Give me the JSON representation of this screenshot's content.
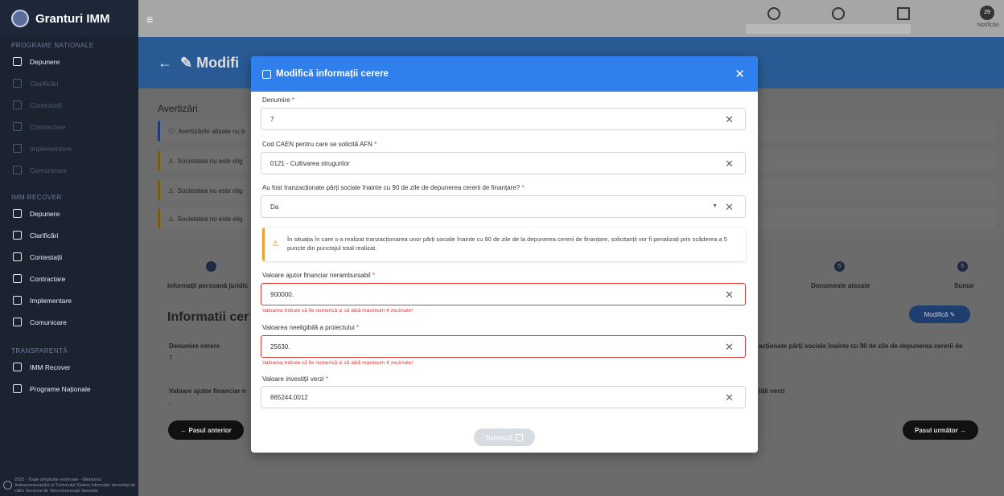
{
  "app": {
    "title": "Granturi IMM"
  },
  "sidebar": {
    "sections": [
      {
        "label": "PROGRAME NATIONALE",
        "items": [
          {
            "label": "Depunere",
            "active": true
          },
          {
            "label": "Clarificări",
            "active": false
          },
          {
            "label": "Contestații",
            "active": false
          },
          {
            "label": "Contractare",
            "active": false
          },
          {
            "label": "Implementare",
            "active": false
          },
          {
            "label": "Comunicare",
            "active": false
          }
        ]
      },
      {
        "label": "IMM RECOVER",
        "items": [
          {
            "label": "Depunere",
            "active": true
          },
          {
            "label": "Clarificări",
            "active": true
          },
          {
            "label": "Contestații",
            "active": true
          },
          {
            "label": "Contractare",
            "active": true
          },
          {
            "label": "Implementare",
            "active": true
          },
          {
            "label": "Comunicare",
            "active": true
          }
        ]
      },
      {
        "label": "TRANSPARENȚĂ",
        "items": [
          {
            "label": "IMM Recover",
            "active": true
          },
          {
            "label": "Programe Naționale",
            "active": true
          }
        ]
      }
    ],
    "footer": "2022 - Toate drepturile rezervate - Ministerul Antreprenoriatului și Turismului Sistem informatic dezvoltat de către Serviciul de Telecomunicații Speciale"
  },
  "topbar": {
    "notifications_label": "Notificări",
    "notifications_count": "29"
  },
  "page": {
    "title": "Modifi"
  },
  "warnings": {
    "title": "Avertizări",
    "rows": [
      "Avertizările afișate nu b",
      "Societatea nu este elig",
      "Societatea nu este elig",
      "Societatea nu este elig"
    ]
  },
  "wizard": {
    "steps_left": [
      "Informații persoană juridic"
    ],
    "steps_right": [
      "Documente atașate",
      "Sumar"
    ],
    "step_numbers": [
      "5",
      "6"
    ],
    "section_title": "Informatii cer",
    "modify_label": "Modifică",
    "field1_label": "Denumire cerere",
    "field1_value": "7",
    "field2_label": "Valoare ajutor financiar n",
    "field2_value": "-",
    "right_label1": "acționate părți sociale înainte cu 90 de zile de depunerea cererii de",
    "right_label2": "tiții verzi",
    "prev_label": "Pasul anterior",
    "next_label": "Pasul următor"
  },
  "modal": {
    "title": "Modifică informații cerere",
    "fields": [
      {
        "label": "Denumire",
        "value": "7",
        "error": ""
      },
      {
        "label": "Cod CAEN pentru care se solicită AFN",
        "value": "0121 - Cultivarea strugurilor",
        "error": ""
      },
      {
        "label": "Au fost tranzacționate părți sociale înainte cu 90 de zile de depunerea cererii de finanțare?",
        "value": "Da",
        "error": ""
      },
      {
        "label": "Valoare ajutor financiar nerambursabil",
        "value": "900000.",
        "error": "Valoarea trebuie să fie numerică și să aibă maximum 4 zecimale!"
      },
      {
        "label": "Valoarea neeligibilă a proiectului",
        "value": "25630.",
        "error": "Valoarea trebuie să fie numerică și să aibă maximum 4 zecimale!"
      },
      {
        "label": "Valoare investiții verzi",
        "value": "865244.0012",
        "error": ""
      }
    ],
    "alert": "În situația în care s-a realizat tranzacționarea unor părți sociale înainte cu 90 de zile de la depunerea cererii de finanțare, solicitanții vor fi penalizați prin scăderea a 5 puncte din punctajul total realizat.",
    "save_label": "Salvează"
  }
}
